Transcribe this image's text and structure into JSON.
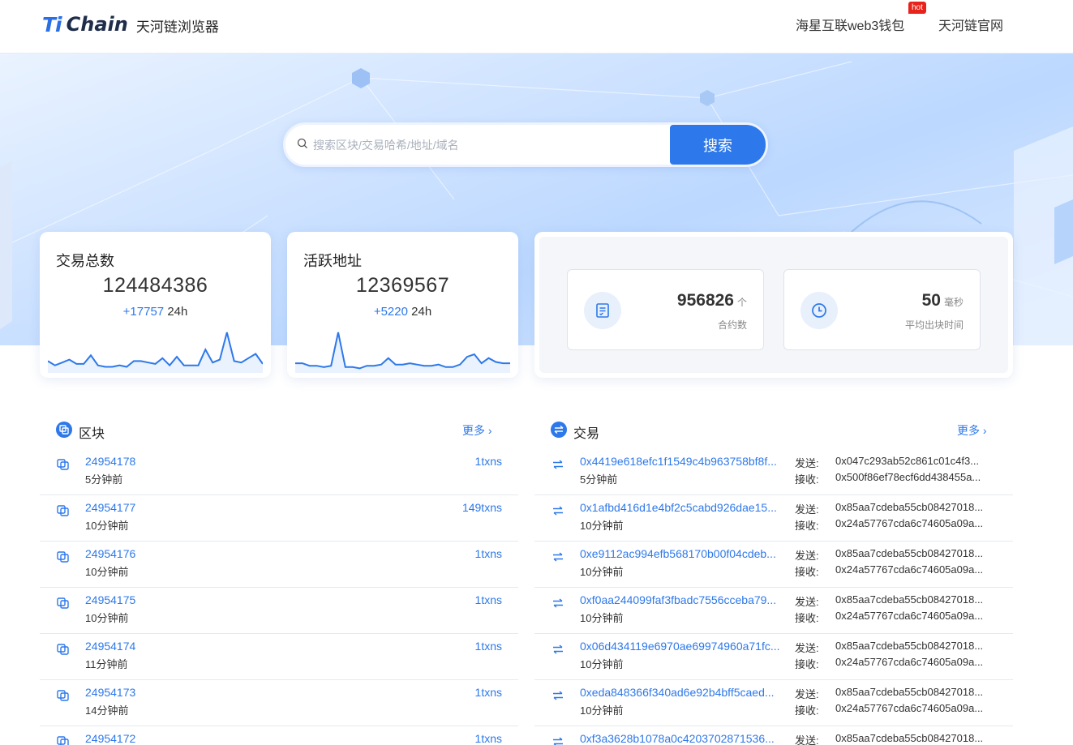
{
  "header": {
    "logo_ti": "Ti",
    "logo_chain": "Chain",
    "logo_subtitle": "天河链浏览器",
    "nav_wallet": "海星互联web3钱包",
    "hot_badge": "hot",
    "nav_official": "天河链官网"
  },
  "search": {
    "placeholder": "搜索区块/交易哈希/地址/域名",
    "button": "搜索"
  },
  "stats": {
    "tx_total": {
      "title": "交易总数",
      "value": "124484386",
      "delta": "+17757",
      "period": "24h",
      "sparkline": [
        6,
        3,
        5,
        7,
        4,
        4,
        10,
        3,
        2,
        2,
        3,
        2,
        6,
        6,
        5,
        4,
        8,
        3,
        9,
        3,
        3,
        3,
        14,
        5,
        7,
        26,
        6,
        5,
        8,
        11,
        4
      ]
    },
    "active_addr": {
      "title": "活跃地址",
      "value": "12369567",
      "delta": "+5220",
      "period": "24h",
      "sparkline": [
        5,
        5,
        3,
        3,
        2,
        3,
        29,
        2,
        2,
        1,
        3,
        3,
        4,
        9,
        4,
        4,
        5,
        4,
        3,
        3,
        4,
        2,
        2,
        4,
        10,
        12,
        5,
        9,
        6,
        5,
        5
      ]
    },
    "contracts": {
      "value": "956826",
      "unit": "个",
      "label": "合约数"
    },
    "block_time": {
      "value": "50",
      "unit": "毫秒",
      "label": "平均出块时间"
    }
  },
  "blocks": {
    "title": "区块",
    "more": "更多",
    "items": [
      {
        "number": "24954178",
        "time": "5分钟前",
        "txns": "1txns"
      },
      {
        "number": "24954177",
        "time": "10分钟前",
        "txns": "149txns"
      },
      {
        "number": "24954176",
        "time": "10分钟前",
        "txns": "1txns"
      },
      {
        "number": "24954175",
        "time": "10分钟前",
        "txns": "1txns"
      },
      {
        "number": "24954174",
        "time": "11分钟前",
        "txns": "1txns"
      },
      {
        "number": "24954173",
        "time": "14分钟前",
        "txns": "1txns"
      },
      {
        "number": "24954172",
        "time": "",
        "txns": "1txns"
      }
    ]
  },
  "transactions": {
    "title": "交易",
    "more": "更多",
    "from_label": "发送:",
    "to_label": "接收:",
    "items": [
      {
        "hash": "0x4419e618efc1f1549c4b963758bf8f...",
        "time": "5分钟前",
        "from": "0x047c293ab52c861c01c4f3...",
        "to": "0x500f86ef78ecf6dd438455a..."
      },
      {
        "hash": "0x1afbd416d1e4bf2c5cabd926dae15...",
        "time": "10分钟前",
        "from": "0x85aa7cdeba55cb08427018...",
        "to": "0x24a57767cda6c74605a09a..."
      },
      {
        "hash": "0xe9112ac994efb568170b00f04cdeb...",
        "time": "10分钟前",
        "from": "0x85aa7cdeba55cb08427018...",
        "to": "0x24a57767cda6c74605a09a..."
      },
      {
        "hash": "0xf0aa244099faf3fbadc7556cceba79...",
        "time": "10分钟前",
        "from": "0x85aa7cdeba55cb08427018...",
        "to": "0x24a57767cda6c74605a09a..."
      },
      {
        "hash": "0x06d434119e6970ae69974960a71fc...",
        "time": "10分钟前",
        "from": "0x85aa7cdeba55cb08427018...",
        "to": "0x24a57767cda6c74605a09a..."
      },
      {
        "hash": "0xeda848366f340ad6e92b4bff5caed...",
        "time": "10分钟前",
        "from": "0x85aa7cdeba55cb08427018...",
        "to": "0x24a57767cda6c74605a09a..."
      },
      {
        "hash": "0xf3a3628b1078a0c4203702871536...",
        "time": "",
        "from": "0x85aa7cdeba55cb08427018...",
        "to": ""
      }
    ]
  },
  "colors": {
    "accent": "#2d78ea",
    "hot": "#e8231b"
  }
}
